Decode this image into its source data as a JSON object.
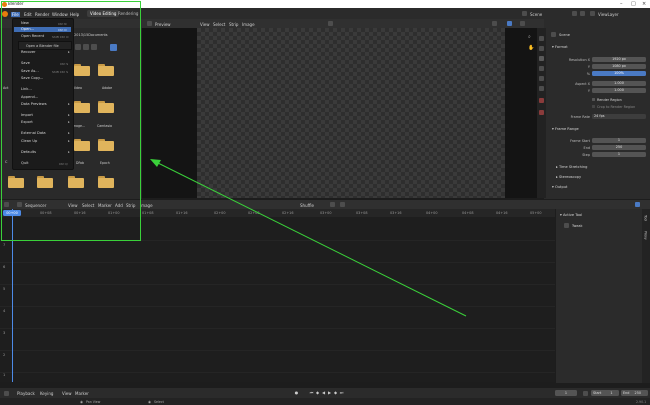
{
  "window": {
    "title": "Blender"
  },
  "menubar": {
    "items": [
      "File",
      "Edit",
      "Render",
      "Window",
      "Help"
    ],
    "workspace_tabs": [
      "Video Editing",
      "Rendering"
    ],
    "scene_label": "Scene",
    "view_layer_label": "ViewLayer"
  },
  "file_browser": {
    "path": "\\2013\\15Documents",
    "items": [
      "",
      "Video",
      "Adobe",
      "Image...",
      "Camtasia",
      "DFab",
      "Epoch"
    ],
    "side_labels": [
      "Act",
      "C"
    ]
  },
  "file_menu": {
    "items": [
      {
        "label": "New",
        "shortcut": "Ctrl N",
        "arrow": true
      },
      {
        "label": "Open...",
        "shortcut": "Ctrl O",
        "highlight": true
      },
      {
        "label": "Open Recent",
        "shortcut": "Shift Ctrl O"
      },
      {
        "label": "Recover",
        "arrow": true
      },
      {
        "label": "Save",
        "shortcut": "Ctrl S"
      },
      {
        "label": "Save As...",
        "shortcut": "Shift Ctrl S"
      },
      {
        "label": "Save Copy..."
      },
      {
        "label": "Link..."
      },
      {
        "label": "Append..."
      },
      {
        "label": "Data Previews",
        "arrow": true
      },
      {
        "label": "Import",
        "arrow": true
      },
      {
        "label": "Export",
        "arrow": true
      },
      {
        "label": "External Data",
        "arrow": true
      },
      {
        "label": "Clean Up",
        "arrow": true
      },
      {
        "label": "Defaults",
        "arrow": true
      },
      {
        "label": "Quit",
        "shortcut": "Ctrl Q"
      }
    ],
    "recent_submenu": "Open a Blender file"
  },
  "preview": {
    "editor_label": "Preview",
    "menu": [
      "View",
      "Select",
      "Strip",
      "Image"
    ]
  },
  "properties": {
    "scene_name": "Scene",
    "format_label": "Format",
    "rows": [
      {
        "label": "Resolution X",
        "value": "1920 px"
      },
      {
        "label": "Y",
        "value": "1080 px"
      },
      {
        "label": "%",
        "value": "100%",
        "blue": true
      },
      {
        "label": "Aspect X",
        "value": "1.000"
      },
      {
        "label": "Y",
        "value": "1.000"
      }
    ],
    "render_region": "Render Region",
    "crop_region": "Crop to Render Region",
    "frame_rate_label": "Frame Rate",
    "frame_rate_value": "24 fps",
    "frame_range_label": "Frame Range",
    "range_rows": [
      {
        "label": "Frame Start",
        "value": "1"
      },
      {
        "label": "End",
        "value": "250"
      },
      {
        "label": "Step",
        "value": "1"
      }
    ],
    "time_stretching": "Time Stretching",
    "stereoscopy": "Stereoscopy",
    "output": "Output"
  },
  "sequencer": {
    "editor_label": "Sequencer",
    "menu": [
      "View",
      "Select",
      "Marker",
      "Add",
      "Strip",
      "Image"
    ],
    "shuffle_label": "Shuffle",
    "current_frame": "00+00",
    "ticks": [
      "00+08",
      "00+16",
      "01+00",
      "01+08",
      "01+16",
      "02+00",
      "02+08",
      "02+16",
      "03+00",
      "03+08",
      "03+16",
      "04+00",
      "04+08",
      "04+16",
      "05+00",
      "05+08",
      "05+16",
      "06+00",
      "06+08",
      "06+16"
    ],
    "channels": [
      "7",
      "6",
      "5",
      "4",
      "3",
      "2",
      "1"
    ],
    "sidebar_section": "Active Tool",
    "sidebar_tool": "Tweak",
    "sidebar_tabs": [
      "Tool",
      "Proxy"
    ]
  },
  "timeline": {
    "menu": [
      "Playback",
      "Keying",
      "View",
      "Marker"
    ],
    "current": "1",
    "start_label": "Start",
    "start_value": "1",
    "end_label": "End",
    "end_value": "250"
  },
  "statusbar": {
    "left": "Pan View",
    "mid": "Select",
    "version": "2.90.1"
  },
  "colors": {
    "highlight": "#3f6db4",
    "selection_box": "#3ad13a",
    "playhead": "#4d8ae6",
    "folder": "#e0b45c"
  }
}
